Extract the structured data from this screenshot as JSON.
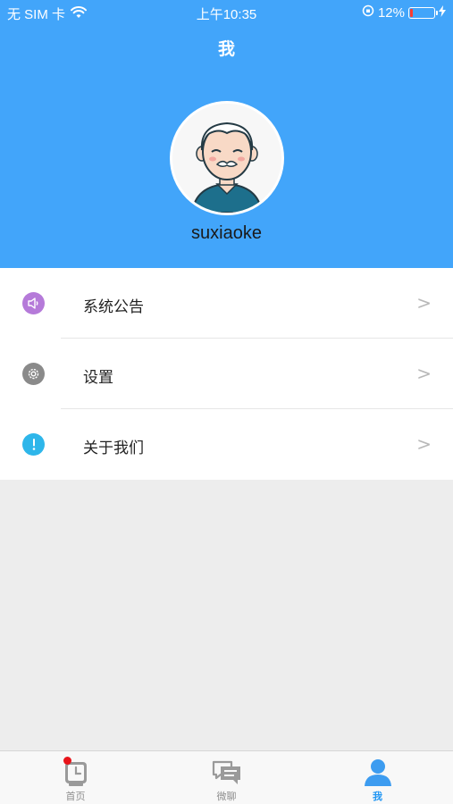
{
  "status_bar": {
    "carrier": "无 SIM 卡",
    "time": "上午10:35",
    "battery_percent": "12%",
    "battery_level": 0.12
  },
  "header": {
    "title": "我",
    "username": "suxiaoke",
    "background_color": "#42a5fa"
  },
  "menu": {
    "items": [
      {
        "label": "系统公告",
        "icon": "speaker-icon",
        "icon_color": "#b57ad9",
        "arrow": ">"
      },
      {
        "label": "设置",
        "icon": "gear-icon",
        "icon_color": "#8a8a8a",
        "arrow": ">"
      },
      {
        "label": "关于我们",
        "icon": "info-icon",
        "icon_color": "#2eb6ea",
        "arrow": ">"
      }
    ]
  },
  "tabbar": {
    "tabs": [
      {
        "label": "首页",
        "icon": "home-clock-icon",
        "active": false,
        "badge": true
      },
      {
        "label": "微聊",
        "icon": "chat-icon",
        "active": false,
        "badge": false
      },
      {
        "label": "我",
        "icon": "person-icon",
        "active": true,
        "badge": false
      }
    ],
    "active_color": "#2196f3"
  }
}
